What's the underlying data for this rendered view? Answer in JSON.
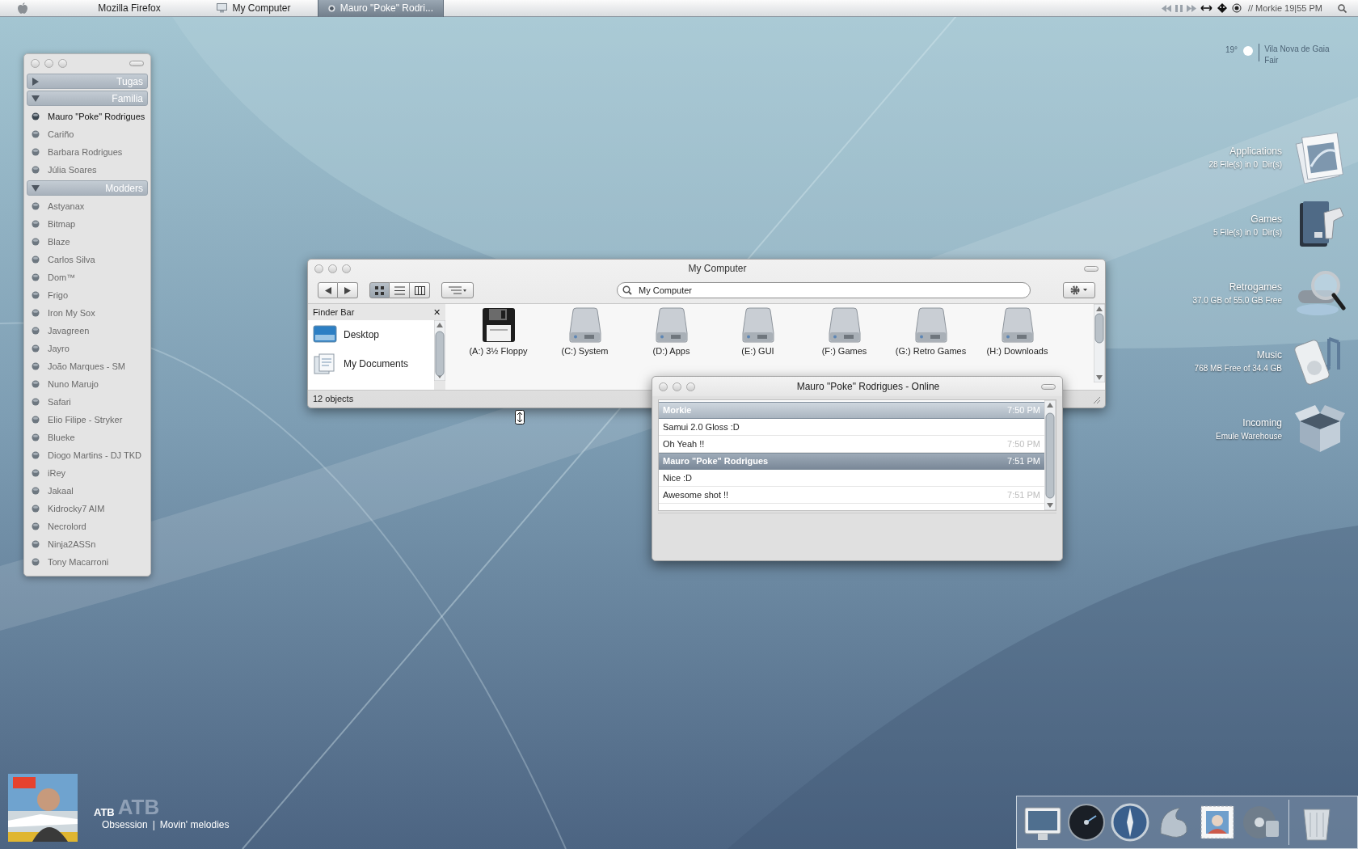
{
  "menubar": {
    "apps": [
      {
        "label": "Mozilla Firefox",
        "kind": "plain",
        "selected": false
      },
      {
        "label": "My Computer",
        "kind": "computer",
        "selected": false
      },
      {
        "label": "Mauro \"Poke\" Rodri...",
        "kind": "chat",
        "selected": true
      }
    ],
    "status": "// Morkie 19|55 PM"
  },
  "weather": {
    "temperature": "19°",
    "city": "Vila Nova de Gaia",
    "condition": "Fair"
  },
  "desktop_items": [
    {
      "name": "Applications",
      "detail": "28 File(s) in 0  Dir(s)",
      "kind": "document"
    },
    {
      "name": "Games",
      "detail": "5 File(s) in 0  Dir(s)",
      "kind": "book"
    },
    {
      "name": "Retrogames",
      "detail": "37.0 GB of 55.0 GB Free",
      "kind": "magnifier"
    },
    {
      "name": "Music",
      "detail": "768 MB Free of 34.4 GB",
      "kind": "player"
    },
    {
      "name": "Incoming",
      "detail": "Emule Warehouse",
      "kind": "box"
    }
  ],
  "contacts": {
    "groups": [
      {
        "name": "Tugas",
        "expanded": false
      },
      {
        "name": "Familia",
        "expanded": true,
        "contacts": [
          {
            "name": "Mauro \"Poke\" Rodrigues",
            "active": true
          },
          {
            "name": "Cariño",
            "active": false
          },
          {
            "name": "Barbara Rodrigues",
            "active": false
          },
          {
            "name": "Júlia Soares",
            "active": false
          }
        ]
      },
      {
        "name": "Modders",
        "expanded": true,
        "contacts": [
          {
            "name": "Astyanax",
            "active": false
          },
          {
            "name": "Bitmap",
            "active": false
          },
          {
            "name": "Blaze",
            "active": false
          },
          {
            "name": "Carlos Silva",
            "active": false
          },
          {
            "name": "Dom™",
            "active": false
          },
          {
            "name": "Frigo",
            "active": false
          },
          {
            "name": "Iron My Sox",
            "active": false
          },
          {
            "name": "Javagreen",
            "active": false
          },
          {
            "name": "Jayro",
            "active": false
          },
          {
            "name": "João Marques - SM",
            "active": false
          },
          {
            "name": "Nuno Marujo",
            "active": false
          },
          {
            "name": "Safari",
            "active": false
          },
          {
            "name": "Elio Filipe - Stryker",
            "active": false
          },
          {
            "name": "Blueke",
            "active": false
          },
          {
            "name": "Diogo Martins - DJ TKD",
            "active": false
          },
          {
            "name": "iRey",
            "active": false
          },
          {
            "name": "Jakaal",
            "active": false
          },
          {
            "name": "Kidrocky7 AIM",
            "active": false
          },
          {
            "name": "Necrolord",
            "active": false
          },
          {
            "name": "Ninja2ASSn",
            "active": false
          },
          {
            "name": "Tony Macarroni",
            "active": false
          }
        ]
      }
    ]
  },
  "finder": {
    "title": "My Computer",
    "search": {
      "value": "My Computer"
    },
    "views": [
      {
        "kind": "icons",
        "selected": true
      },
      {
        "kind": "list",
        "selected": false
      },
      {
        "kind": "columns",
        "selected": false
      }
    ],
    "sidebar": {
      "title": "Finder Bar",
      "close": "✕",
      "items": [
        {
          "label": "Desktop",
          "kind": "desktop"
        },
        {
          "label": "My Documents",
          "kind": "documents"
        }
      ]
    },
    "drives": [
      {
        "label": "(A:) 3½ Floppy",
        "kind": "floppy"
      },
      {
        "label": "(C:) System",
        "kind": "disk"
      },
      {
        "label": "(D:) Apps",
        "kind": "disk"
      },
      {
        "label": "(E:) GUI",
        "kind": "disk"
      },
      {
        "label": "(F:) Games",
        "kind": "disk"
      },
      {
        "label": "(G:) Retro Games",
        "kind": "disk"
      },
      {
        "label": "(H:) Downloads",
        "kind": "disk"
      }
    ],
    "status": "12 objects"
  },
  "chat": {
    "title": "Mauro \"Poke\" Rodrigues - Online",
    "blocks": [
      {
        "sender": "Morkie",
        "time": "7:50 PM",
        "kind": "me",
        "messages": [
          {
            "text": "Samui 2.0 Gloss :D"
          },
          {
            "text": "Oh Yeah !!",
            "time": "7:50 PM"
          }
        ]
      },
      {
        "sender": "Mauro \"Poke\" Rodrigues",
        "time": "7:51 PM",
        "kind": "buddy",
        "messages": [
          {
            "text": "Nice :D"
          },
          {
            "text": "Awesome shot !!",
            "time": "7:51 PM"
          }
        ]
      }
    ]
  },
  "now_playing": {
    "backdrop": "ATB",
    "artist": "ATB",
    "track": "Obsession",
    "separator": "|",
    "album": "Movin' melodies"
  }
}
